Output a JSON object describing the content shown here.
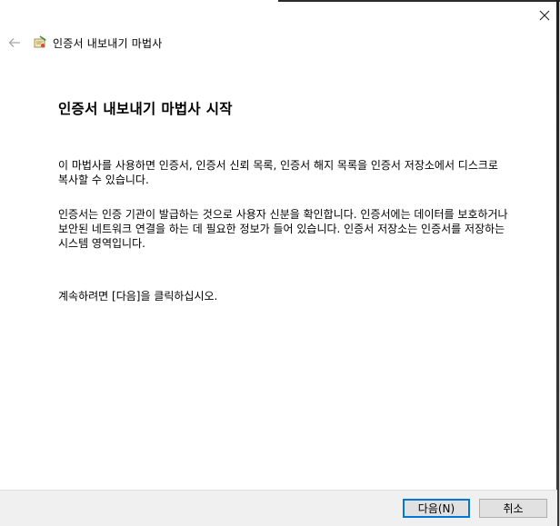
{
  "window": {
    "wizard_title": "인증서 내보내기 마법사"
  },
  "icons": {
    "back": "back-arrow-icon",
    "wizard": "certificate-wizard-icon",
    "close": "close-icon"
  },
  "main": {
    "heading": "인증서 내보내기 마법사 시작",
    "paragraphs": [
      "이 마법사를 사용하면 인증서, 인증서 신뢰 목록, 인증서 해지 목록을 인증서 저장소에서 디스크로 복사할 수 있습니다.",
      "인증서는 인증 기관이 발급하는 것으로 사용자 신분을 확인합니다. 인증서에는 데이터를 보호하거나 보안된 네트워크 연결을 하는 데 필요한 정보가 들어 있습니다. 인증서 저장소는 인증서를 저장하는 시스템 영역입니다.",
      "계속하려면 [다음]을 클릭하십시오."
    ]
  },
  "footer": {
    "next_label": "다음(N)",
    "cancel_label": "취소"
  },
  "colors": {
    "accent": "#0078d7",
    "footer_bg": "#f0f0f0"
  }
}
